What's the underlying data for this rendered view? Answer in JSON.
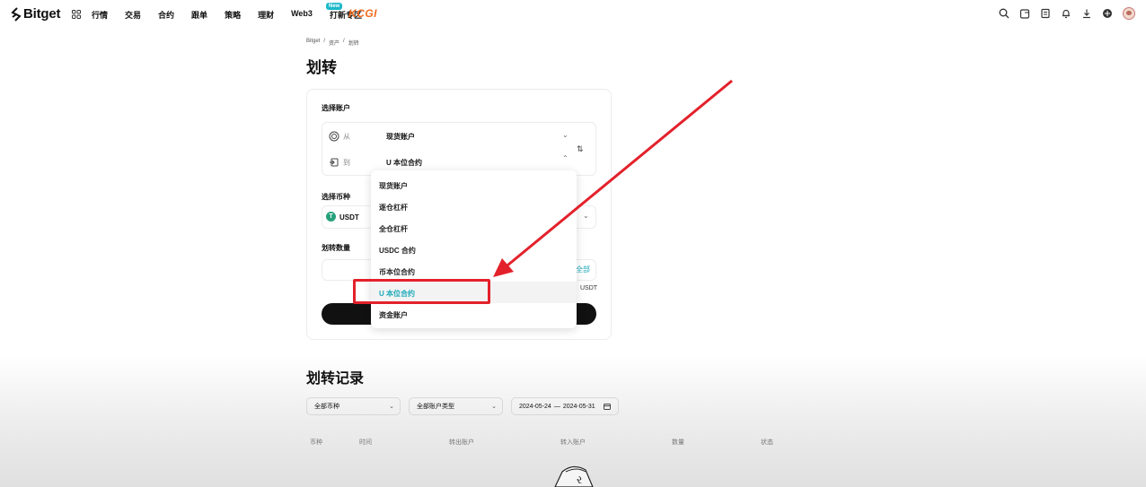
{
  "nav": {
    "brand": "Bitget",
    "items": [
      "行情",
      "交易",
      "合约",
      "跟单",
      "策略",
      "理财",
      "Web3",
      "打新专区"
    ],
    "new_badge": "New",
    "partner": "KCGI"
  },
  "breadcrumb": [
    "Bitget",
    "/",
    "资产",
    "/",
    "划转"
  ],
  "page_title": "划转",
  "transfer": {
    "select_account_label": "选择账户",
    "from_key": "从",
    "from_value": "现货账户",
    "to_key": "到",
    "to_value": "U 本位合约",
    "select_coin_label": "选择币种",
    "coin": "USDT",
    "amount_label": "划转数量",
    "all_label": "全部",
    "unit": "USDT"
  },
  "dropdown": {
    "items": [
      "现货账户",
      "逐仓杠杆",
      "全仓杠杆",
      "USDC 合约",
      "币本位合约",
      "U 本位合约",
      "资金账户"
    ],
    "selected": "U 本位合约"
  },
  "records": {
    "title": "划转记录",
    "filter_coin": "全部币种",
    "filter_type": "全部账户类型",
    "date_start": "2024-05-24",
    "date_sep": "—",
    "date_end": "2024-05-31",
    "columns": [
      "币种",
      "时间",
      "转出账户",
      "转入账户",
      "数量",
      "状态"
    ]
  },
  "colors": {
    "accent": "#19a9b8",
    "annotation": "#e3212b",
    "tether": "#26a17b",
    "partner": "#f26b1d"
  }
}
